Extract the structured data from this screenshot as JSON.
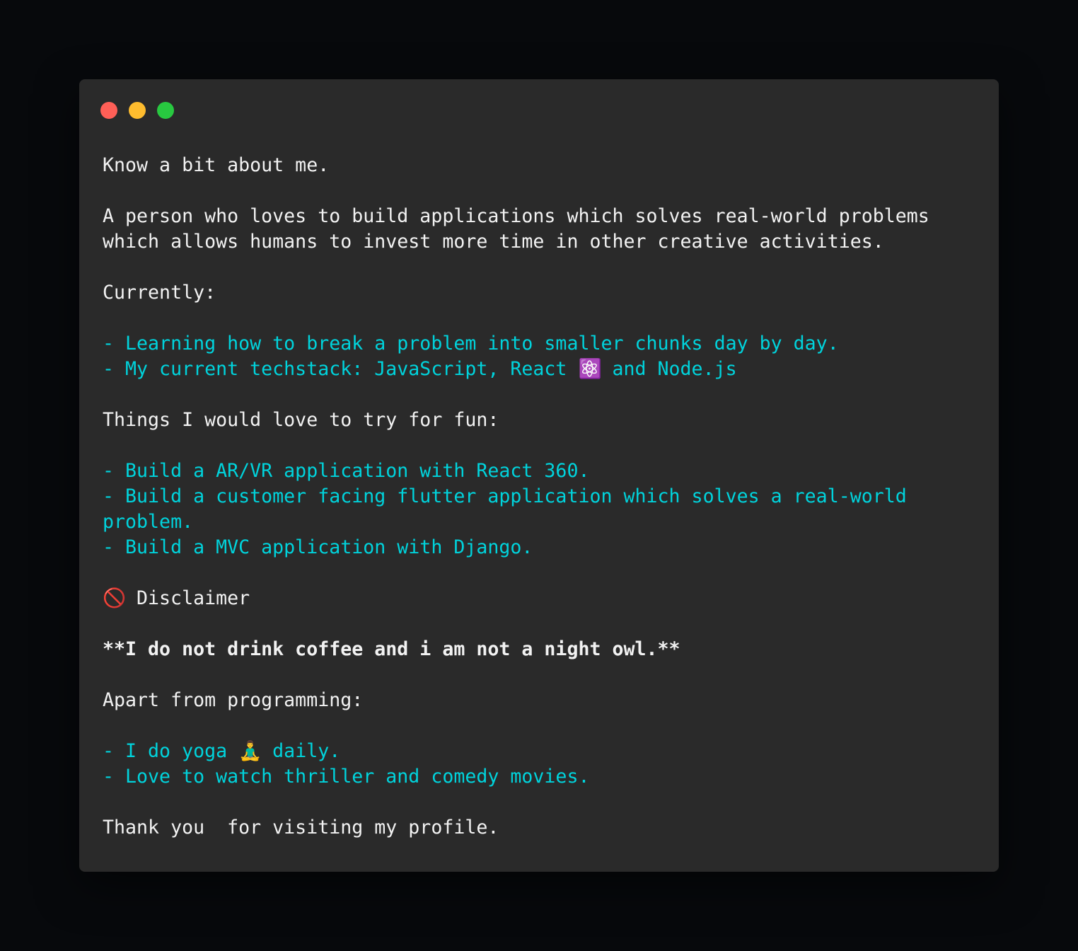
{
  "window": {
    "controls": {
      "close_color": "#ff5f57",
      "minimize_color": "#febc2e",
      "maximize_color": "#28c840"
    }
  },
  "colors": {
    "text": "#f2f2f2",
    "accent": "#00d3dc",
    "background": "#2a2a2a"
  },
  "content": {
    "intro": "Know a bit about me.",
    "bio_1": "A person who loves to build applications which solves real-world problems",
    "bio_2": "which allows humans to invest more time in other creative activities.",
    "currently_heading": "Currently:",
    "currently_1": "- Learning how to break a problem into smaller chunks day by day.",
    "currently_2a": "- My current techstack: JavaScript, React ",
    "currently_2_emoji": "⚛️",
    "currently_2b": " and Node.js",
    "fun_heading": "Things I would love to try for fun:",
    "fun_1": "- Build a AR/VR application with React 360.",
    "fun_2a": "- Build a customer facing flutter application which solves a real-world",
    "fun_2b": "problem.",
    "fun_3": "- Build a MVC application with Django.",
    "disclaimer_emoji": "🚫",
    "disclaimer_label": " Disclaimer",
    "disclaimer_text": "**I do not drink coffee and i am not a night owl.**",
    "apart_heading": "Apart from programming:",
    "apart_1a": "- I do yoga ",
    "apart_1_emoji": "🧘‍♂️",
    "apart_1b": " daily.",
    "apart_2": "- Love to watch thriller and comedy movies.",
    "closing": "Thank you  for visiting my profile."
  }
}
